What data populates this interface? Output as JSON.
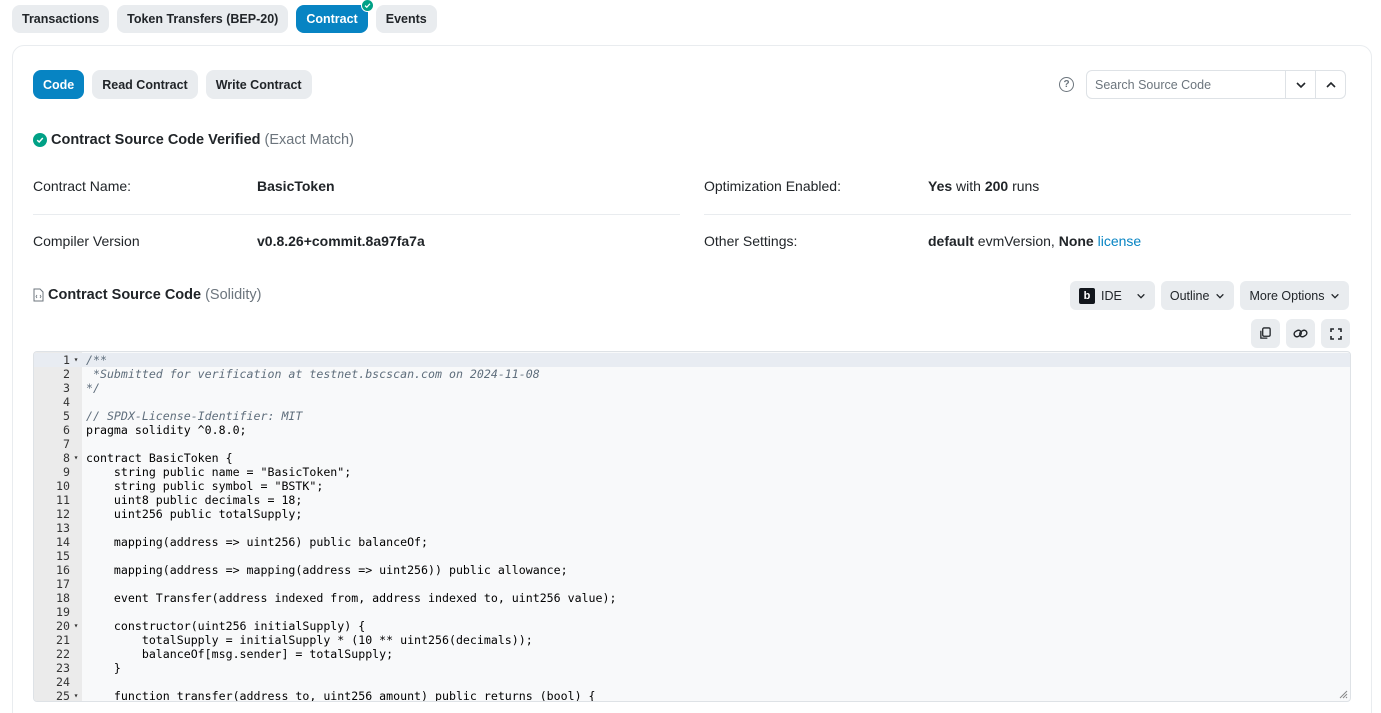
{
  "top_tabs": [
    {
      "label": "Transactions",
      "active": false
    },
    {
      "label": "Token Transfers (BEP-20)",
      "active": false
    },
    {
      "label": "Contract",
      "active": true
    },
    {
      "label": "Events",
      "active": false
    }
  ],
  "sub_tabs": [
    {
      "label": "Code",
      "active": true
    },
    {
      "label": "Read Contract",
      "active": false
    },
    {
      "label": "Write Contract",
      "active": false
    }
  ],
  "search": {
    "placeholder": "Search Source Code"
  },
  "verified": {
    "title": "Contract Source Code Verified",
    "match": "(Exact Match)"
  },
  "info": {
    "contract_name_label": "Contract Name:",
    "contract_name_value": "BasicToken",
    "compiler_label": "Compiler Version",
    "compiler_value": "v0.8.26+commit.8a97fa7a",
    "optimization_label": "Optimization Enabled:",
    "optimization_yes": "Yes",
    "optimization_with": " with ",
    "optimization_runs": "200",
    "optimization_runs_suffix": " runs",
    "other_label": "Other Settings:",
    "other_default": "default",
    "other_evm": " evmVersion, ",
    "other_none": "None",
    "other_license": "license"
  },
  "source": {
    "title": "Contract Source Code",
    "lang": "(Solidity)"
  },
  "toolbar": {
    "ide": "IDE",
    "outline": "Outline",
    "more": "More Options"
  },
  "colors": {
    "primary": "#0784c3",
    "success": "#00a186",
    "pill_bg": "#e9ecef"
  },
  "code_lines": [
    "/**",
    " *Submitted for verification at testnet.bscscan.com on 2024-11-08",
    "*/",
    "",
    "// SPDX-License-Identifier: MIT",
    "pragma solidity ^0.8.0;",
    "",
    "contract BasicToken {",
    "    string public name = \"BasicToken\";",
    "    string public symbol = \"BSTK\";",
    "    uint8 public decimals = 18;",
    "    uint256 public totalSupply;",
    "",
    "    mapping(address => uint256) public balanceOf;",
    "",
    "    mapping(address => mapping(address => uint256)) public allowance;",
    "",
    "    event Transfer(address indexed from, address indexed to, uint256 value);",
    "",
    "    constructor(uint256 initialSupply) {",
    "        totalSupply = initialSupply * (10 ** uint256(decimals));",
    "        balanceOf[msg.sender] = totalSupply;",
    "    }",
    "",
    "    function transfer(address to, uint256 amount) public returns (bool) {"
  ],
  "fold_lines": [
    1,
    8,
    20,
    25
  ]
}
